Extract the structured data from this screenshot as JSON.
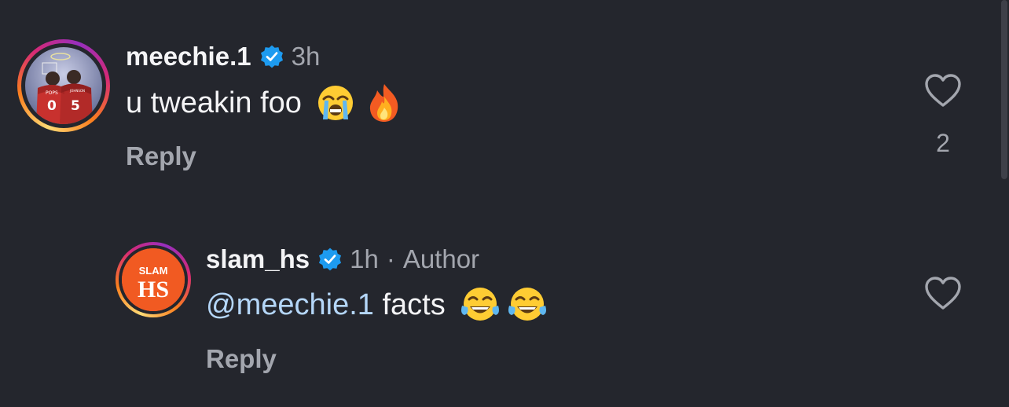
{
  "comments": [
    {
      "username": "meechie.1",
      "time": "3h",
      "text": "u tweakin foo",
      "emojis": [
        "loudly-crying-face",
        "fire"
      ],
      "reply_label": "Reply",
      "likes": "2",
      "avatar_text_1": "POPS",
      "avatar_text_2": "JOHNSON",
      "avatar_numbers": [
        "0",
        "5"
      ]
    },
    {
      "username": "slam_hs",
      "time": "1h",
      "separator": "·",
      "author_badge": "Author",
      "mention": "@meechie.1",
      "text": " facts",
      "emojis": [
        "face-with-tears-of-joy",
        "face-with-tears-of-joy"
      ],
      "reply_label": "Reply",
      "avatar_text_1": "SLAM",
      "avatar_text_2": "HS"
    }
  ],
  "colors": {
    "background": "#24262d",
    "verified": "#1d9bf0",
    "mention": "#b4d6f8",
    "muted": "#a3a6ae",
    "slam_orange": "#f15a22"
  }
}
